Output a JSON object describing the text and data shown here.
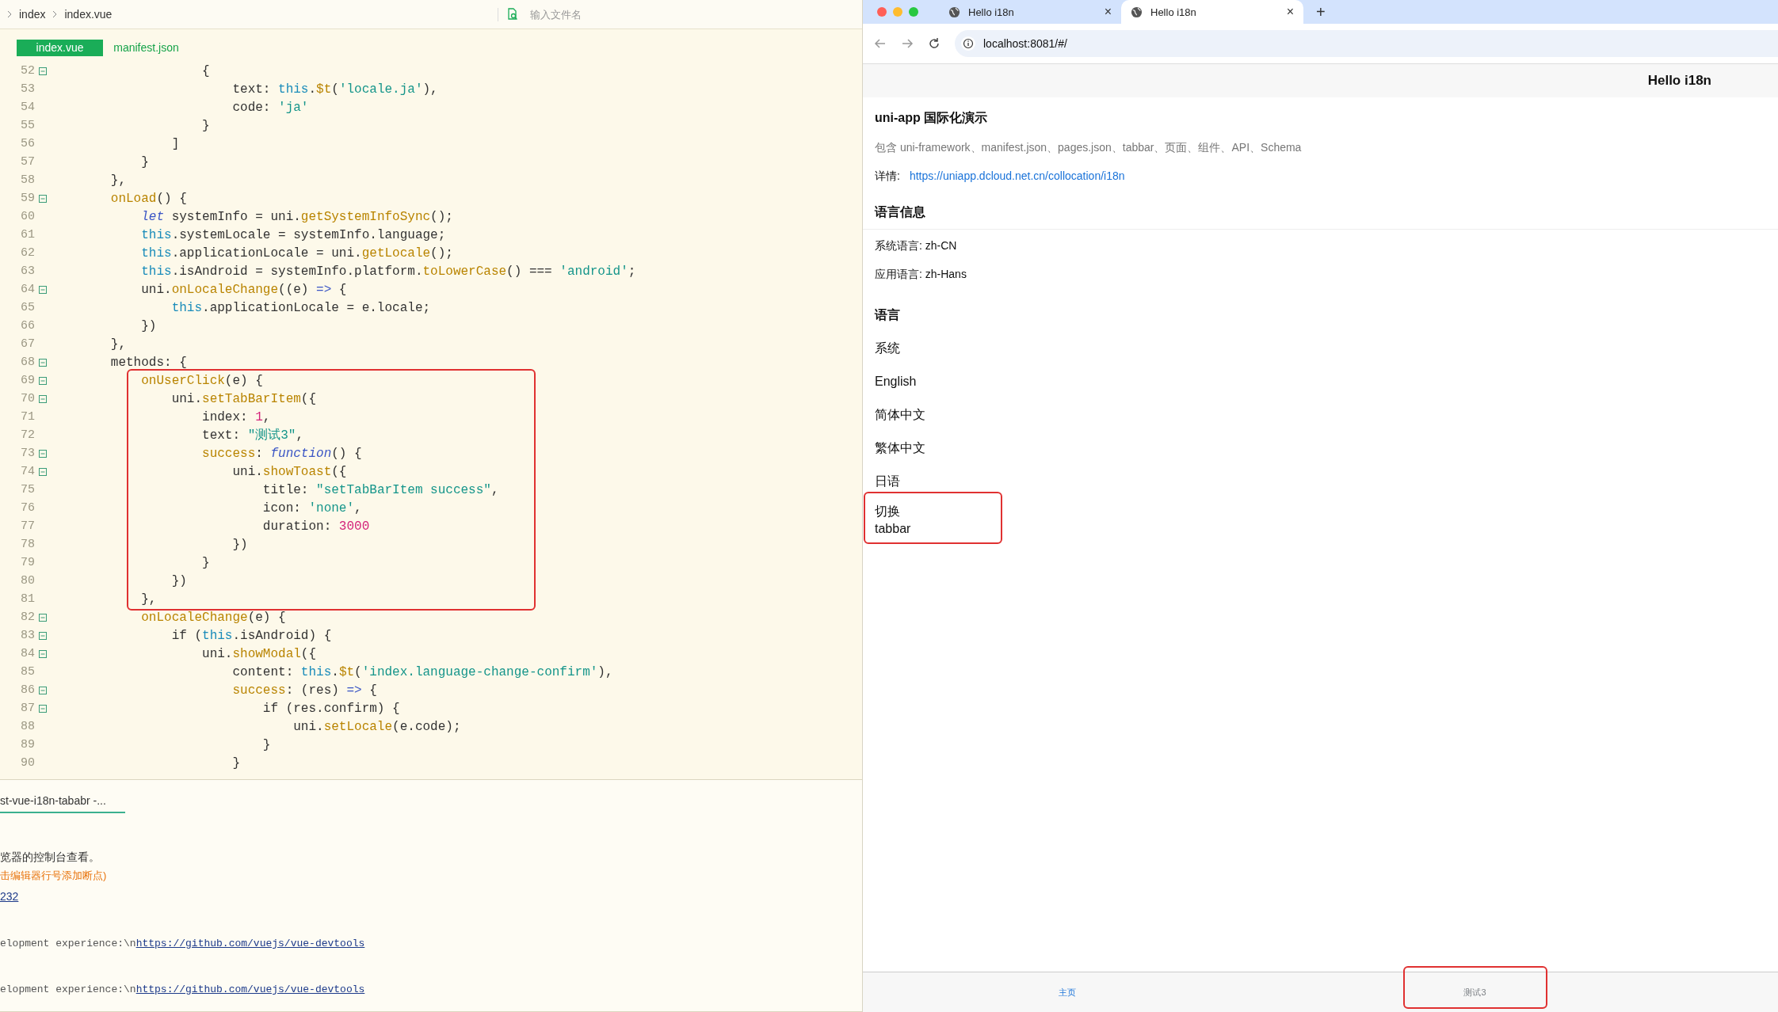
{
  "editor": {
    "breadcrumb": [
      "index",
      "index.vue"
    ],
    "file_search": {
      "placeholder": "输入文件名"
    },
    "file_tabs": [
      {
        "label": "index.vue",
        "selected": true
      },
      {
        "label": "manifest.json",
        "selected": false
      }
    ],
    "code_blocks": [
      {
        "highlighted": false,
        "lines": [
          {
            "number": "52",
            "foldable": true,
            "tokens": [
              {
                "kind": "plain",
                "t": "                    {"
              }
            ]
          },
          {
            "number": "53",
            "foldable": false,
            "tokens": [
              {
                "kind": "plain",
                "t": "                        text: "
              },
              {
                "kind": "keyword",
                "t": "this"
              },
              {
                "kind": "plain",
                "t": "."
              },
              {
                "kind": "function",
                "t": "$t"
              },
              {
                "kind": "plain",
                "t": "("
              },
              {
                "kind": "string",
                "t": "'locale.ja'"
              },
              {
                "kind": "plain",
                "t": "),"
              }
            ]
          },
          {
            "number": "54",
            "foldable": false,
            "tokens": [
              {
                "kind": "plain",
                "t": "                        code: "
              },
              {
                "kind": "string",
                "t": "'ja'"
              }
            ]
          },
          {
            "number": "55",
            "foldable": false,
            "tokens": [
              {
                "kind": "plain",
                "t": "                    }"
              }
            ]
          },
          {
            "number": "56",
            "foldable": false,
            "tokens": [
              {
                "kind": "plain",
                "t": "                ]"
              }
            ]
          },
          {
            "number": "57",
            "foldable": false,
            "tokens": [
              {
                "kind": "plain",
                "t": "            }"
              }
            ]
          },
          {
            "number": "58",
            "foldable": false,
            "tokens": [
              {
                "kind": "plain",
                "t": "        },"
              }
            ]
          },
          {
            "number": "59",
            "foldable": true,
            "tokens": [
              {
                "kind": "function",
                "t": "        onLoad"
              },
              {
                "kind": "plain",
                "t": "() {"
              }
            ]
          },
          {
            "number": "60",
            "foldable": false,
            "tokens": [
              {
                "kind": "italic",
                "t": "            let"
              },
              {
                "kind": "plain",
                "t": " systemInfo = uni."
              },
              {
                "kind": "function",
                "t": "getSystemInfoSync"
              },
              {
                "kind": "plain",
                "t": "();"
              }
            ]
          },
          {
            "number": "61",
            "foldable": false,
            "tokens": [
              {
                "kind": "keyword",
                "t": "            this"
              },
              {
                "kind": "plain",
                "t": ".systemLocale = systemInfo.language;"
              }
            ]
          },
          {
            "number": "62",
            "foldable": false,
            "tokens": [
              {
                "kind": "keyword",
                "t": "            this"
              },
              {
                "kind": "plain",
                "t": ".applicationLocale = uni."
              },
              {
                "kind": "function",
                "t": "getLocale"
              },
              {
                "kind": "plain",
                "t": "();"
              }
            ]
          },
          {
            "number": "63",
            "foldable": false,
            "tokens": [
              {
                "kind": "keyword",
                "t": "            this"
              },
              {
                "kind": "plain",
                "t": ".isAndroid = systemInfo.platform."
              },
              {
                "kind": "function",
                "t": "toLowerCase"
              },
              {
                "kind": "plain",
                "t": "() === "
              },
              {
                "kind": "string",
                "t": "'android'"
              },
              {
                "kind": "plain",
                "t": ";"
              }
            ]
          },
          {
            "number": "64",
            "foldable": true,
            "tokens": [
              {
                "kind": "plain",
                "t": "            uni."
              },
              {
                "kind": "function",
                "t": "onLocaleChange"
              },
              {
                "kind": "plain",
                "t": "((e) "
              },
              {
                "kind": "operator",
                "t": "=>"
              },
              {
                "kind": "plain",
                "t": " {"
              }
            ]
          },
          {
            "number": "65",
            "foldable": false,
            "tokens": [
              {
                "kind": "keyword",
                "t": "                this"
              },
              {
                "kind": "plain",
                "t": ".applicationLocale = e.locale;"
              }
            ]
          },
          {
            "number": "66",
            "foldable": false,
            "tokens": [
              {
                "kind": "plain",
                "t": "            })"
              }
            ]
          },
          {
            "number": "67",
            "foldable": false,
            "tokens": [
              {
                "kind": "plain",
                "t": "        },"
              }
            ]
          },
          {
            "number": "68",
            "foldable": true,
            "tokens": [
              {
                "kind": "plain",
                "t": "        methods: {"
              }
            ]
          }
        ]
      },
      {
        "highlighted": true,
        "lines": [
          {
            "number": "69",
            "foldable": true,
            "tokens": [
              {
                "kind": "function",
                "t": "            onUserClick"
              },
              {
                "kind": "plain",
                "t": "(e) {"
              }
            ]
          },
          {
            "number": "70",
            "foldable": true,
            "tokens": [
              {
                "kind": "plain",
                "t": "                uni."
              },
              {
                "kind": "function",
                "t": "setTabBarItem"
              },
              {
                "kind": "plain",
                "t": "({"
              }
            ]
          },
          {
            "number": "71",
            "foldable": false,
            "tokens": [
              {
                "kind": "plain",
                "t": "                    index: "
              },
              {
                "kind": "number",
                "t": "1"
              },
              {
                "kind": "plain",
                "t": ","
              }
            ]
          },
          {
            "number": "72",
            "foldable": false,
            "tokens": [
              {
                "kind": "plain",
                "t": "                    text: "
              },
              {
                "kind": "string",
                "t": "\"测试3\""
              },
              {
                "kind": "plain",
                "t": ","
              }
            ]
          },
          {
            "number": "73",
            "foldable": true,
            "tokens": [
              {
                "kind": "function",
                "t": "                    success"
              },
              {
                "kind": "plain",
                "t": ": "
              },
              {
                "kind": "italic",
                "t": "function"
              },
              {
                "kind": "plain",
                "t": "() {"
              }
            ]
          },
          {
            "number": "74",
            "foldable": true,
            "tokens": [
              {
                "kind": "plain",
                "t": "                        uni."
              },
              {
                "kind": "function",
                "t": "showToast"
              },
              {
                "kind": "plain",
                "t": "({"
              }
            ]
          },
          {
            "number": "75",
            "foldable": false,
            "tokens": [
              {
                "kind": "plain",
                "t": "                            title: "
              },
              {
                "kind": "string",
                "t": "\"setTabBarItem success\""
              },
              {
                "kind": "plain",
                "t": ","
              }
            ]
          },
          {
            "number": "76",
            "foldable": false,
            "tokens": [
              {
                "kind": "plain",
                "t": "                            icon: "
              },
              {
                "kind": "string",
                "t": "'none'"
              },
              {
                "kind": "plain",
                "t": ","
              }
            ]
          },
          {
            "number": "77",
            "foldable": false,
            "tokens": [
              {
                "kind": "plain",
                "t": "                            duration: "
              },
              {
                "kind": "number",
                "t": "3000"
              }
            ]
          },
          {
            "number": "78",
            "foldable": false,
            "tokens": [
              {
                "kind": "plain",
                "t": "                        })"
              }
            ]
          },
          {
            "number": "79",
            "foldable": false,
            "tokens": [
              {
                "kind": "plain",
                "t": "                    }"
              }
            ]
          },
          {
            "number": "80",
            "foldable": false,
            "tokens": [
              {
                "kind": "plain",
                "t": "                })"
              }
            ]
          },
          {
            "number": "81",
            "foldable": false,
            "tokens": [
              {
                "kind": "plain",
                "t": "            },"
              }
            ]
          }
        ]
      },
      {
        "highlighted": false,
        "lines": [
          {
            "number": "82",
            "foldable": true,
            "tokens": [
              {
                "kind": "function",
                "t": "            onLocaleChange"
              },
              {
                "kind": "plain",
                "t": "(e) {"
              }
            ]
          },
          {
            "number": "83",
            "foldable": true,
            "tokens": [
              {
                "kind": "plain",
                "t": "                if ("
              },
              {
                "kind": "keyword",
                "t": "this"
              },
              {
                "kind": "plain",
                "t": ".isAndroid) {"
              }
            ]
          },
          {
            "number": "84",
            "foldable": true,
            "tokens": [
              {
                "kind": "plain",
                "t": "                    uni."
              },
              {
                "kind": "function",
                "t": "showModal"
              },
              {
                "kind": "plain",
                "t": "({"
              }
            ]
          },
          {
            "number": "85",
            "foldable": false,
            "tokens": [
              {
                "kind": "plain",
                "t": "                        content: "
              },
              {
                "kind": "keyword",
                "t": "this"
              },
              {
                "kind": "plain",
                "t": "."
              },
              {
                "kind": "function",
                "t": "$t"
              },
              {
                "kind": "plain",
                "t": "("
              },
              {
                "kind": "string",
                "t": "'index.language-change-confirm'"
              },
              {
                "kind": "plain",
                "t": "),"
              }
            ]
          },
          {
            "number": "86",
            "foldable": true,
            "tokens": [
              {
                "kind": "function",
                "t": "                        success"
              },
              {
                "kind": "plain",
                "t": ": (res) "
              },
              {
                "kind": "operator",
                "t": "=>"
              },
              {
                "kind": "plain",
                "t": " {"
              }
            ]
          },
          {
            "number": "87",
            "foldable": true,
            "tokens": [
              {
                "kind": "plain",
                "t": "                            if (res.confirm) {"
              }
            ]
          },
          {
            "number": "88",
            "foldable": false,
            "tokens": [
              {
                "kind": "plain",
                "t": "                                uni."
              },
              {
                "kind": "function",
                "t": "setLocale"
              },
              {
                "kind": "plain",
                "t": "(e.code);"
              }
            ]
          },
          {
            "number": "89",
            "foldable": false,
            "tokens": [
              {
                "kind": "plain",
                "t": "                            }"
              }
            ]
          },
          {
            "number": "90",
            "foldable": false,
            "tokens": [
              {
                "kind": "plain",
                "t": "                        }"
              }
            ]
          }
        ]
      }
    ],
    "console": {
      "tab": {
        "label": "st-vue-i18n-tababr -..."
      },
      "lines": [
        {
          "kind": "info",
          "parts": [
            {
              "kind": "text",
              "t": "览器的控制台查看。"
            }
          ]
        },
        {
          "kind": "warn",
          "parts": [
            {
              "kind": "text",
              "t": "击编辑器行号添加断点)"
            }
          ]
        },
        {
          "kind": "info",
          "parts": [
            {
              "kind": "link",
              "t": "232"
            }
          ]
        },
        {
          "kind": "log",
          "parts": [
            {
              "kind": "text",
              "t": "elopment experience:\\n"
            },
            {
              "kind": "link",
              "t": "https://github.com/vuejs/vue-devtools"
            }
          ]
        },
        {
          "kind": "log",
          "parts": [
            {
              "kind": "text",
              "t": "elopment experience:\\n"
            },
            {
              "kind": "link",
              "t": "https://github.com/vuejs/vue-devtools"
            }
          ]
        }
      ]
    }
  },
  "browser": {
    "tabs": [
      {
        "title": "Hello i18n",
        "selected": false,
        "close": "×"
      },
      {
        "title": "Hello i18n",
        "selected": true,
        "close": "×"
      }
    ],
    "new_tab": "+",
    "address": "localhost:8081/#/",
    "page": {
      "nav_title": "Hello i18n",
      "title": "uni-app 国际化演示",
      "description": "包含 uni-framework、manifest.json、pages.json、tabbar、页面、组件、API、Schema",
      "detail_label": "详情:",
      "detail_link": "https://uniapp.dcloud.net.cn/collocation/i18n",
      "info_heading": "语言信息",
      "info": [
        "系统语言: zh-CN",
        "应用语言: zh-Hans"
      ],
      "language_heading": "语言",
      "languages": [
        "系统",
        "English",
        "简体中文",
        "繁体中文",
        "日语"
      ],
      "switch_button": {
        "label": "切换 tabbar",
        "highlighted": true
      }
    },
    "tabbar": [
      {
        "label": "主页",
        "selected": true,
        "highlighted": false
      },
      {
        "label": "测试3",
        "selected": false,
        "highlighted": true
      }
    ]
  }
}
